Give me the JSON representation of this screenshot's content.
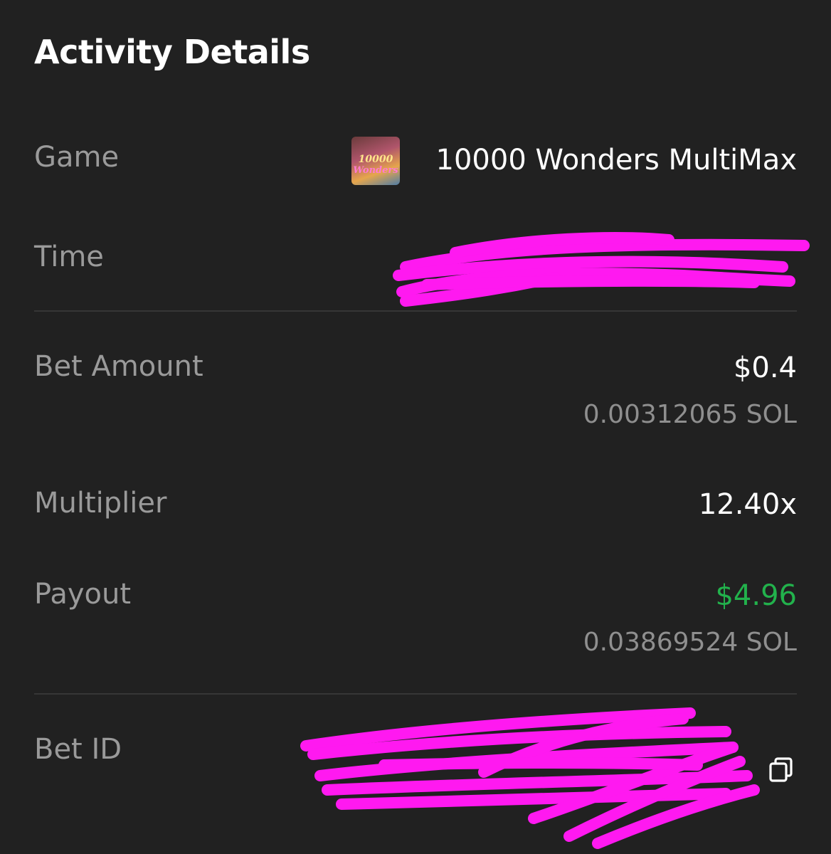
{
  "header": {
    "title": "Activity Details"
  },
  "rows": {
    "game": {
      "label": "Game",
      "value": "10000 Wonders MultiMax",
      "thumb_line1": "10000",
      "thumb_line2": "Wonders"
    },
    "time": {
      "label": "Time"
    },
    "bet_amount": {
      "label": "Bet Amount",
      "usd": "$0.4",
      "crypto": "0.00312065 SOL"
    },
    "multiplier": {
      "label": "Multiplier",
      "value": "12.40x"
    },
    "payout": {
      "label": "Payout",
      "usd": "$4.96",
      "crypto": "0.03869524 SOL"
    },
    "bet_id": {
      "label": "Bet ID"
    }
  },
  "colors": {
    "background": "#212121",
    "payout_green": "#22b24c",
    "redaction_magenta": "#ff19f0"
  },
  "icons": {
    "copy": "copy-icon"
  }
}
